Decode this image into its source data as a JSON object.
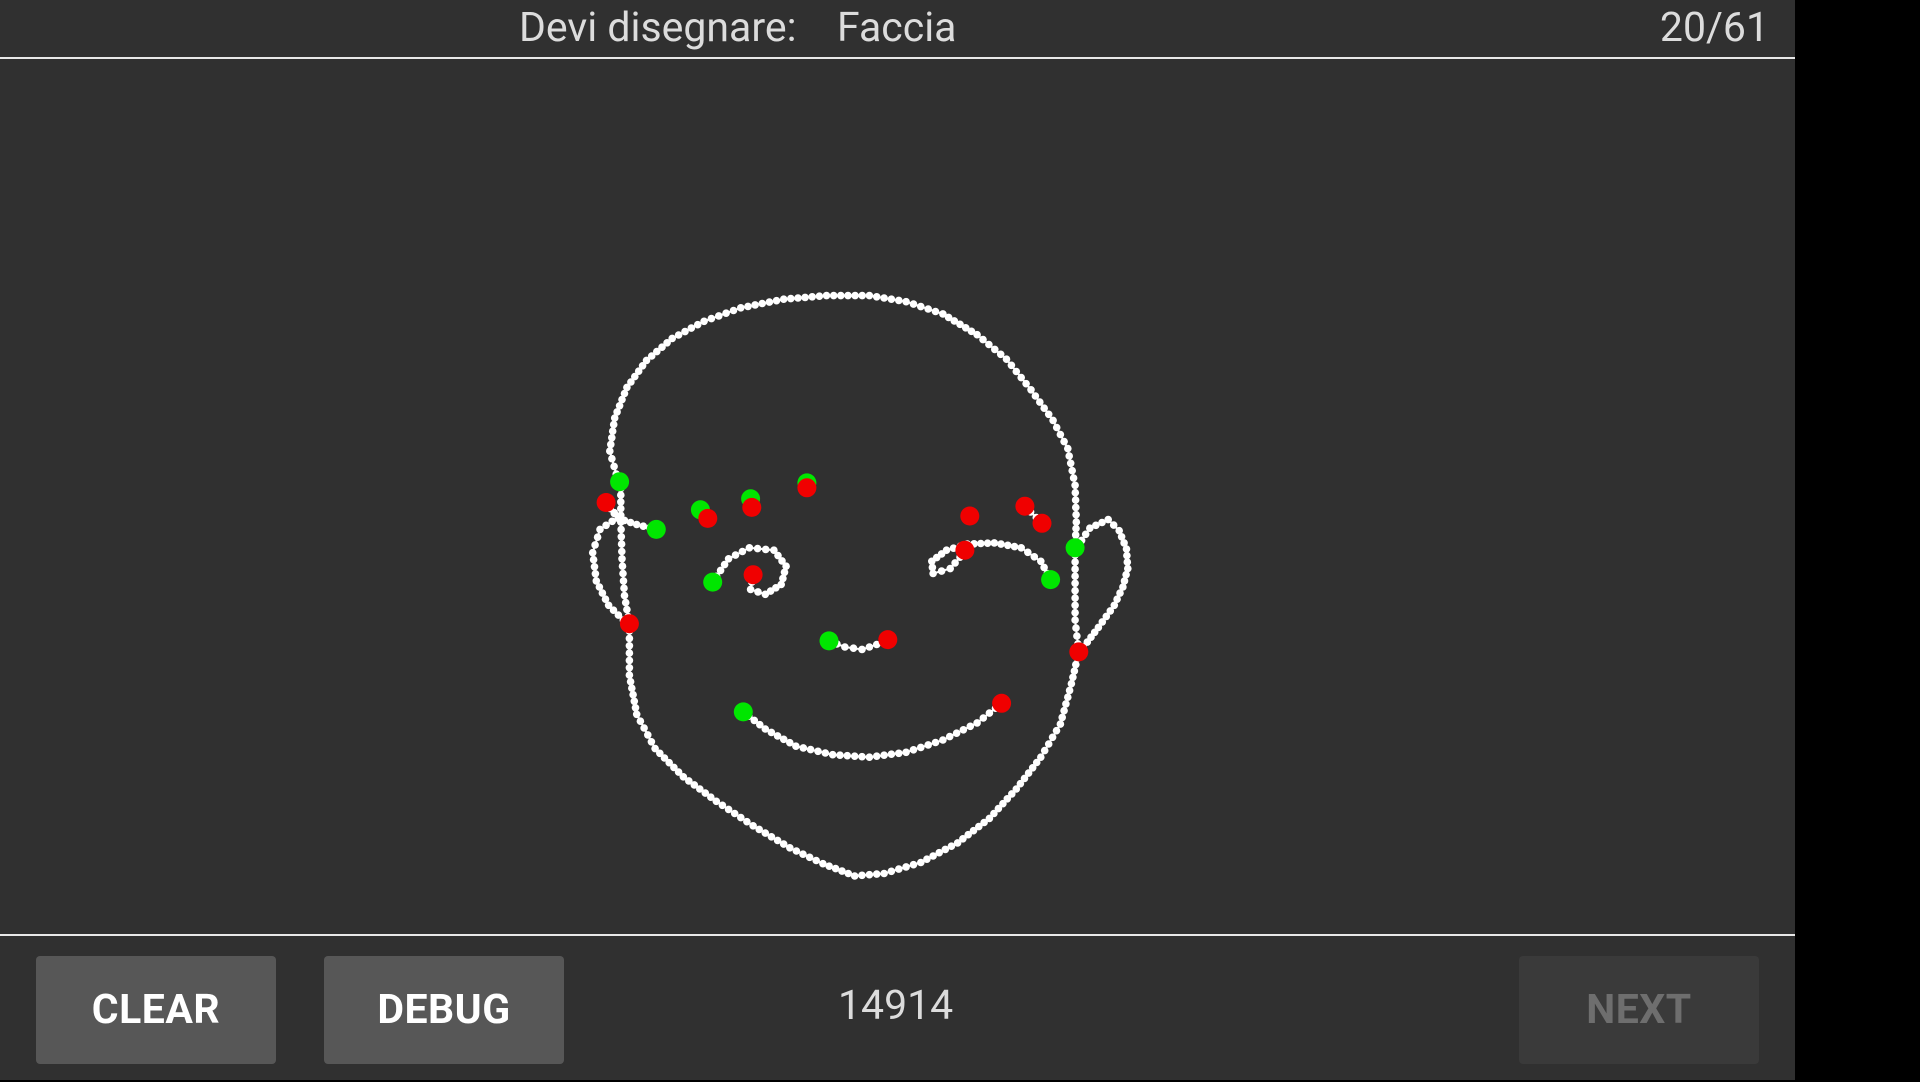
{
  "header": {
    "prompt_label": "Devi disegnare:",
    "prompt_word": "Faccia",
    "progress": "20/61"
  },
  "footer": {
    "clear_label": "CLEAR",
    "debug_label": "DEBUG",
    "score": "14914",
    "next_label": "NEXT",
    "next_enabled": false
  },
  "colors": {
    "background": "#303030",
    "stroke_point": "#ffffff",
    "start_marker": "#00e600",
    "end_marker": "#f00000",
    "button_bg": "#575757",
    "button_disabled_bg": "#3a3a3a"
  }
}
